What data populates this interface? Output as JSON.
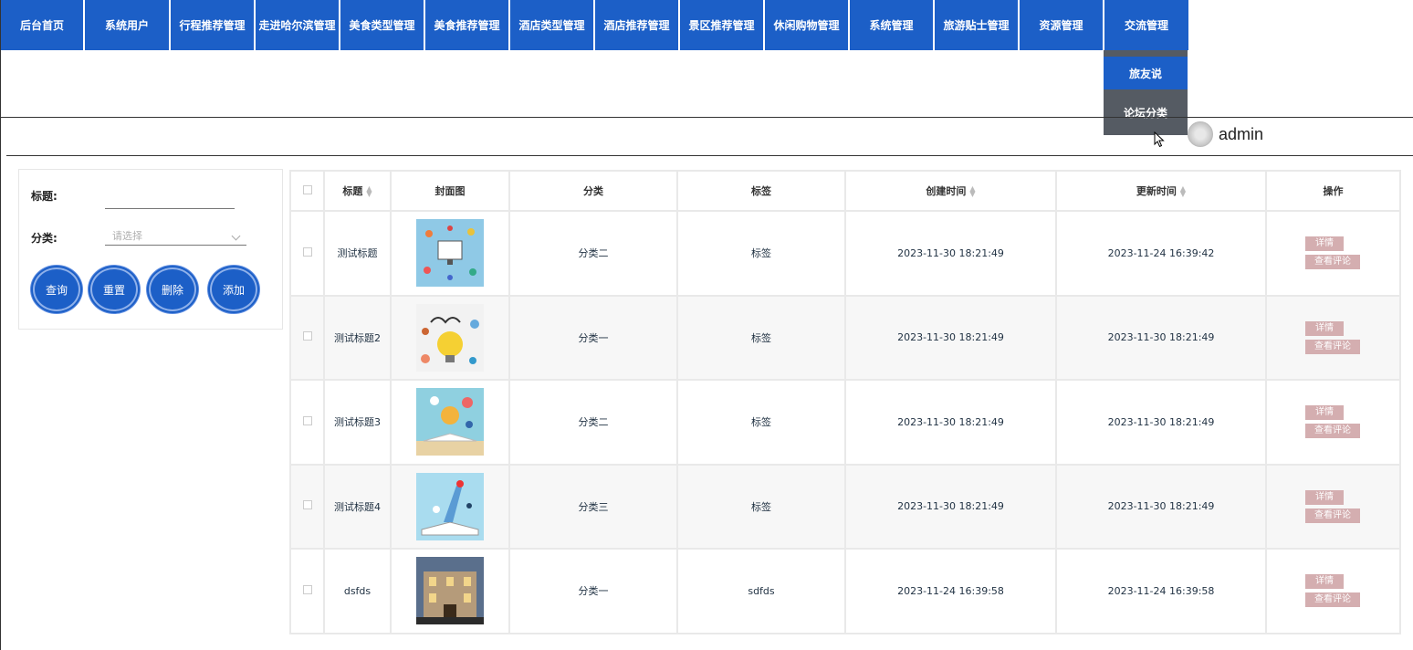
{
  "nav": {
    "items": [
      {
        "label": "后台首页"
      },
      {
        "label": "系统用户"
      },
      {
        "label": "行程推荐管理"
      },
      {
        "label": "走进哈尔滨管理"
      },
      {
        "label": "美食类型管理"
      },
      {
        "label": "美食推荐管理"
      },
      {
        "label": "酒店类型管理"
      },
      {
        "label": "酒店推荐管理"
      },
      {
        "label": "景区推荐管理"
      },
      {
        "label": "休闲购物管理"
      },
      {
        "label": "系统管理"
      },
      {
        "label": "旅游贴士管理"
      },
      {
        "label": "资源管理"
      },
      {
        "label": "交流管理"
      }
    ],
    "dropdown": [
      {
        "label": "旅友说"
      },
      {
        "label": "论坛分类"
      }
    ]
  },
  "user": {
    "name": "admin"
  },
  "search": {
    "title_label": "标题:",
    "title_value": "",
    "category_label": "分类:",
    "category_placeholder": "请选择",
    "buttons": {
      "query": "查询",
      "reset": "重置",
      "delete": "删除",
      "add": "添加"
    }
  },
  "table": {
    "headers": {
      "title": "标题",
      "cover": "封面图",
      "category": "分类",
      "tag": "标签",
      "created": "创建时间",
      "updated": "更新时间",
      "actions": "操作"
    },
    "rows": [
      {
        "title": "测试标题",
        "category": "分类二",
        "tag": "标签",
        "created": "2023-11-30 18:21:49",
        "updated": "2023-11-24 16:39:42",
        "detail": "详情",
        "comments": "查看评论"
      },
      {
        "title": "测试标题2",
        "category": "分类一",
        "tag": "标签",
        "created": "2023-11-30 18:21:49",
        "updated": "2023-11-30 18:21:49",
        "detail": "详情",
        "comments": "查看评论"
      },
      {
        "title": "测试标题3",
        "category": "分类二",
        "tag": "标签",
        "created": "2023-11-30 18:21:49",
        "updated": "2023-11-30 18:21:49",
        "detail": "详情",
        "comments": "查看评论"
      },
      {
        "title": "测试标题4",
        "category": "分类三",
        "tag": "标签",
        "created": "2023-11-30 18:21:49",
        "updated": "2023-11-30 18:21:49",
        "detail": "详情",
        "comments": "查看评论"
      },
      {
        "title": "dsfds",
        "category": "分类一",
        "tag": "sdfds",
        "created": "2023-11-24 16:39:58",
        "updated": "2023-11-24 16:39:58",
        "detail": "详情",
        "comments": "查看评论"
      }
    ]
  },
  "colors": {
    "primary": "#1c5fc7",
    "dropdown_hover": "#555b63",
    "action_button": "#d4aeb0"
  }
}
